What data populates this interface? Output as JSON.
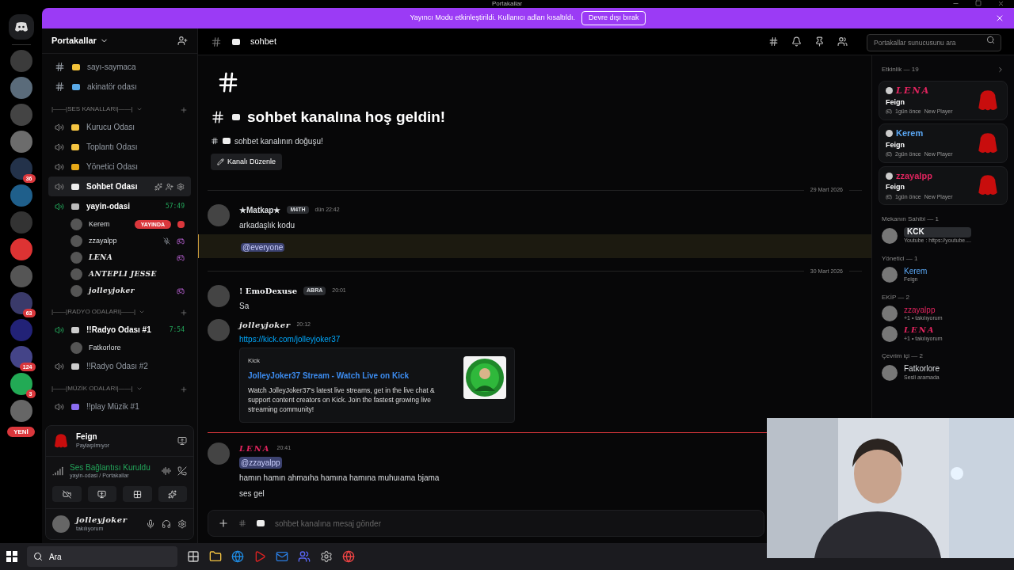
{
  "window": {
    "title": "Portakallar"
  },
  "servers": [
    {
      "kind": "server"
    },
    {
      "kind": "server"
    },
    {
      "kind": "server"
    },
    {
      "kind": "server"
    },
    {
      "kind": "server",
      "badge": "36"
    },
    {
      "kind": "server"
    },
    {
      "kind": "server"
    },
    {
      "kind": "server"
    },
    {
      "kind": "server"
    },
    {
      "kind": "server",
      "badge": "63"
    },
    {
      "kind": "server"
    },
    {
      "kind": "server",
      "badge": "124"
    },
    {
      "kind": "server",
      "badge": "3"
    },
    {
      "kind": "server"
    }
  ],
  "new_label": "YENİ",
  "banner": {
    "text": "Yayıncı Modu etkinleştirildi. Kullanıcı adları kısaltıldı.",
    "button": "Devre dışı bırak"
  },
  "server_name": "Portakallar",
  "channels": [
    {
      "kind": "text",
      "name": "sayı-saymaca",
      "selected": false
    },
    {
      "kind": "text",
      "name": "akinatör odası",
      "selected": false
    },
    {
      "kind": "category",
      "name": "|——|SES KANALLARI|——|"
    },
    {
      "kind": "voice",
      "name": "Kurucu Odası",
      "selected": false,
      "active": false
    },
    {
      "kind": "voice",
      "name": "Toplantı Odası",
      "selected": false,
      "active": false
    },
    {
      "kind": "voice",
      "name": "Yönetici Odası",
      "selected": false,
      "active": false
    },
    {
      "kind": "voice",
      "name": "Sohbet Odası",
      "selected": true,
      "active": false
    },
    {
      "kind": "voice",
      "name": "yayin-odasi",
      "selected": false,
      "active": true,
      "timer": "57:49"
    },
    {
      "kind": "user",
      "name": "Kerem",
      "live": "YAYINDA",
      "muted": false
    },
    {
      "kind": "user",
      "name": "zzayalpp",
      "muted": true,
      "game": true
    },
    {
      "kind": "user",
      "name": "LENA",
      "muted": false,
      "game": true
    },
    {
      "kind": "user",
      "name": "ANTEPLI JESSE",
      "muted": false,
      "game": false
    },
    {
      "kind": "user",
      "name": "jolleyjoker",
      "muted": false,
      "game": true
    },
    {
      "kind": "category",
      "name": "|——|RADYO ODALARI|——|"
    },
    {
      "kind": "voice",
      "name": "!!Radyo Odası #1",
      "selected": false,
      "active": true,
      "timer": "7:54"
    },
    {
      "kind": "user",
      "name": "Fatkorlore",
      "muted": false,
      "game": false
    },
    {
      "kind": "voice",
      "name": "!!Radyo Odası #2",
      "selected": false,
      "active": false
    },
    {
      "kind": "category",
      "name": "|——|MÜZİK ODALARI|——|"
    },
    {
      "kind": "voice",
      "name": "!!play Müzik #1",
      "selected": false,
      "active": false
    }
  ],
  "voice_panel": {
    "activity_user": "Feign",
    "activity_status": "Paylaşılmıyor",
    "connection": "Ses Bağlantısı Kuruldu",
    "location": "yayin-odasi / Portakallar"
  },
  "me": {
    "name": "jolleyjoker",
    "status": "takılıyorum"
  },
  "channel_header": {
    "name": "sohbet",
    "search_placeholder": "Portakallar sunucusunu ara"
  },
  "welcome": {
    "title": "sohbet kanalına hoş geldin!",
    "subtitle": "sohbet kanalının doğuşu!",
    "edit_button": "Kanalı Düzenle"
  },
  "messages": [
    {
      "kind": "divider",
      "text": "29 Mart 2026"
    },
    {
      "kind": "message",
      "author": "★Matkap★",
      "tag": "M4TH",
      "time": "dün 22:42",
      "lines": [
        "arkadaşlık kodu"
      ],
      "mention": "@everyone",
      "highlighted": true
    },
    {
      "kind": "divider",
      "text": "30 Mart 2026"
    },
    {
      "kind": "message",
      "author": "! EmoDexuse",
      "tag": "ABRA",
      "time": "20:01",
      "lines": [
        "Sa"
      ]
    },
    {
      "kind": "message",
      "author": "jolleyjoker",
      "time": "20:12",
      "link": "https://kick.com/jolleyjoker37",
      "embed": {
        "provider": "Kick",
        "title": "JolleyJoker37 Stream - Watch Live on Kick",
        "description": "Watch JolleyJoker37's latest live streams, get in the live chat & support content creators on Kick. Join the fastest growing live streaming community!"
      }
    },
    {
      "kind": "new"
    },
    {
      "kind": "message",
      "author": "LENA",
      "color": "#e0245e",
      "time": "20:41",
      "mention": "@zzayalpp",
      "lines": [
        "hamın hamın ahmaıha hamına hamına muhuıama bjama",
        "ses gel"
      ]
    }
  ],
  "composer": {
    "placeholder": "sohbet kanalına mesaj gönder"
  },
  "members": {
    "activity_title": "Etkinlik — 19",
    "activity": [
      {
        "user": "LENA",
        "color": "#e0245e",
        "game": "Feign",
        "when": "1gün önce",
        "badge": "New Player"
      },
      {
        "user": "Kerem",
        "color": "#5ba8f5",
        "game": "Feign",
        "when": "2gün önce",
        "badge": "New Player"
      },
      {
        "user": "zzayalpp",
        "color": "#e0245e",
        "game": "Feign",
        "when": "1gün önce",
        "badge": "New Player"
      }
    ],
    "groups": [
      {
        "title": "Mekanın Sahibi — 1",
        "members": [
          {
            "name": "KCK",
            "status": "Youtube : https://youtube...."
          }
        ]
      },
      {
        "title": "Yönetici — 1",
        "members": [
          {
            "name": "Kerem",
            "color": "#5ba8f5",
            "status": "Feign"
          }
        ]
      },
      {
        "title": "EKİP — 2",
        "members": [
          {
            "name": "zzayalpp",
            "color": "#e0245e",
            "status": "+1 • takılıyorum"
          },
          {
            "name": "LENA",
            "color": "#e0245e",
            "status": "+1 • takılıyorum"
          }
        ]
      },
      {
        "title": "Çevrim içi — 2",
        "members": [
          {
            "name": "Fatkorlore",
            "status": "Sesli aramada"
          }
        ]
      }
    ]
  },
  "taskbar": {
    "search": "Ara"
  }
}
